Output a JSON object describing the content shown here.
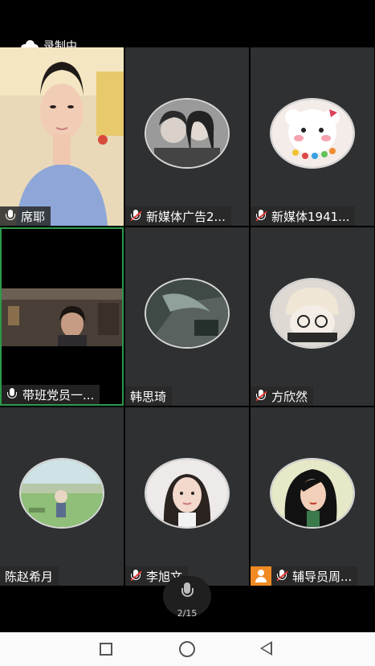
{
  "recording": {
    "label": "录制中",
    "icon": "cloud-icon"
  },
  "participants": [
    {
      "name": "席耶",
      "mic": "on",
      "video": "live"
    },
    {
      "name": "新媒体广告2...",
      "mic": "muted",
      "video": "avatar"
    },
    {
      "name": "新媒体1941...",
      "mic": "muted",
      "video": "avatar"
    },
    {
      "name": "带班党员一...",
      "mic": "on",
      "video": "live",
      "active_speaker": true
    },
    {
      "name": "韩思琦",
      "mic": "none",
      "video": "avatar"
    },
    {
      "name": "方欣然",
      "mic": "muted",
      "video": "avatar"
    },
    {
      "name": "陈赵希月",
      "mic": "none",
      "video": "avatar"
    },
    {
      "name": "李旭文",
      "mic": "muted",
      "video": "avatar"
    },
    {
      "name": "辅导员周...",
      "mic": "muted",
      "video": "avatar",
      "host": true
    }
  ],
  "pager": {
    "text": "2/15"
  },
  "colors": {
    "tile_bg": "#2f3032",
    "active_border": "#2c9a4a",
    "host_badge": "#f08a24",
    "mute_slash": "#e53935"
  }
}
